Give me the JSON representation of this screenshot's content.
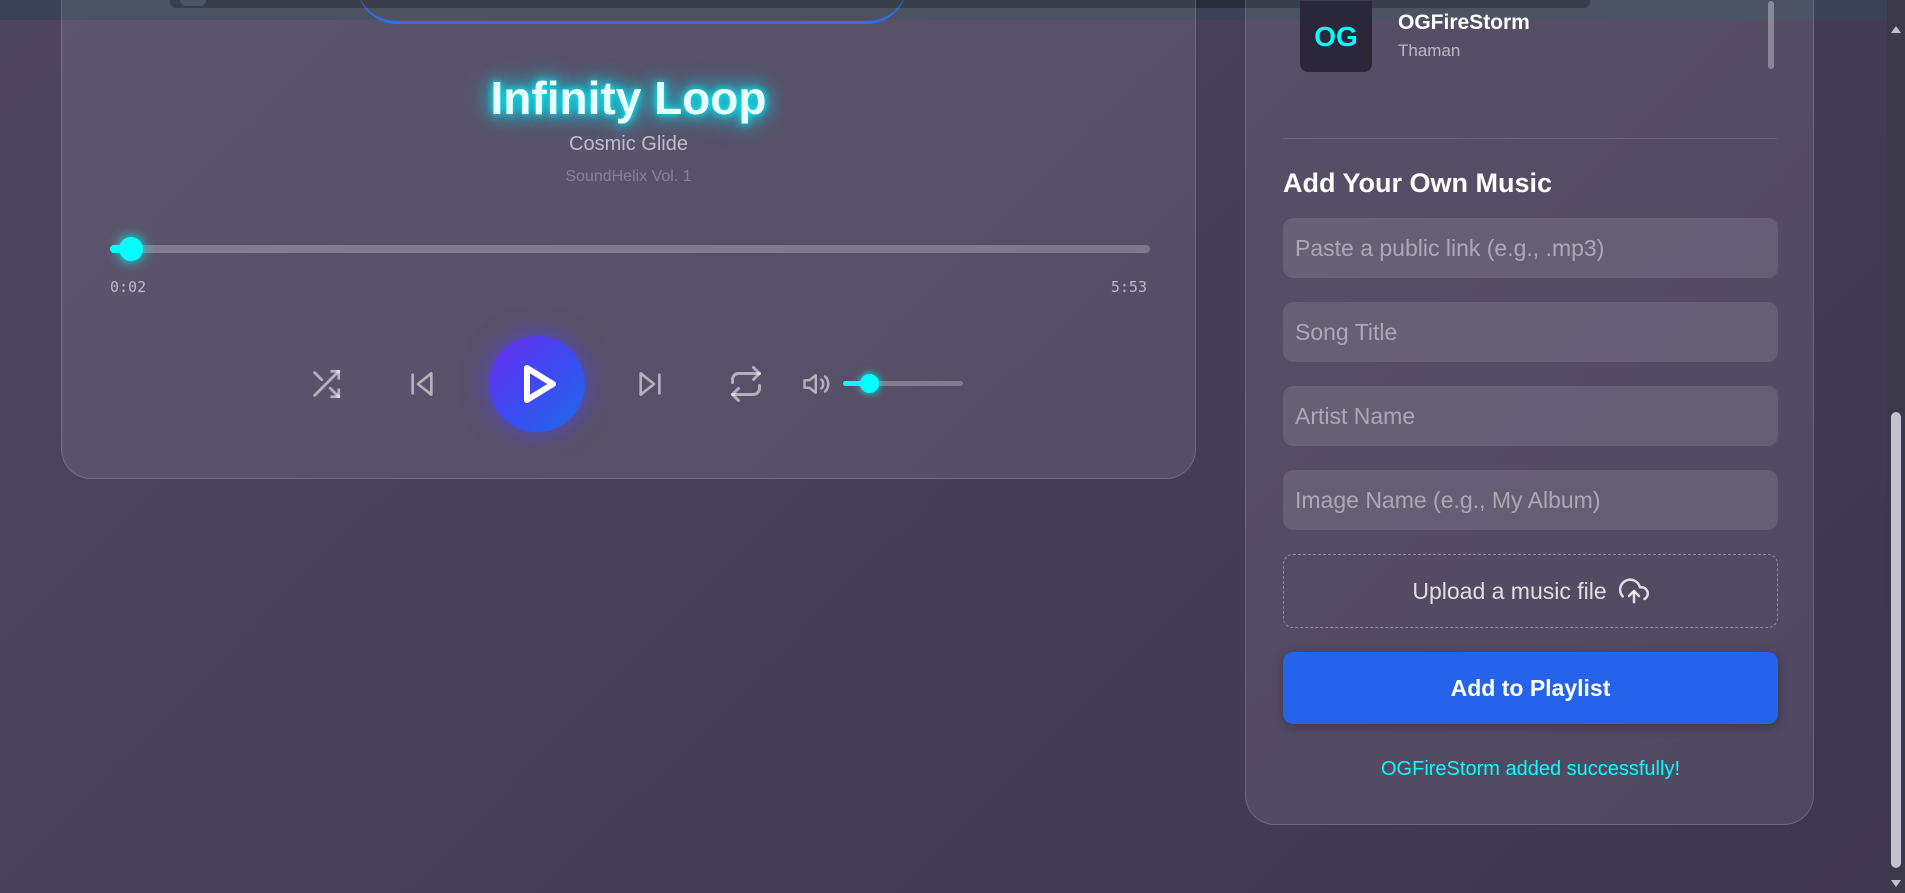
{
  "player": {
    "title": "Infinity Loop",
    "artist": "Cosmic Glide",
    "album": "SoundHelix Vol. 1",
    "current_time": "0:02",
    "total_time": "5:53",
    "progress_fraction": 0.02,
    "volume_fraction": 0.22,
    "accent_color": "#00ffff",
    "play_gradient": [
      "#6a2cf0",
      "#1f6be8"
    ]
  },
  "controls": {
    "shuffle_icon": "shuffle-icon",
    "previous_icon": "skip-previous-icon",
    "play_icon": "play-icon",
    "next_icon": "skip-next-icon",
    "repeat_icon": "repeat-icon",
    "volume_icon": "volume-icon"
  },
  "playlist": {
    "items": [
      {
        "thumb": "OG",
        "title": "OGFireStorm",
        "artist": "Thaman"
      }
    ]
  },
  "form": {
    "heading": "Add Your Own Music",
    "link_placeholder": "Paste a public link (e.g., .mp3)",
    "title_placeholder": "Song Title",
    "artist_placeholder": "Artist Name",
    "image_placeholder": "Image Name (e.g., My Album)",
    "upload_label": "Upload a music file",
    "upload_icon": "cloud-upload-icon",
    "submit_label": "Add to Playlist",
    "button_color": "#2563eb",
    "success_message": "OGFireStorm added successfully!"
  }
}
